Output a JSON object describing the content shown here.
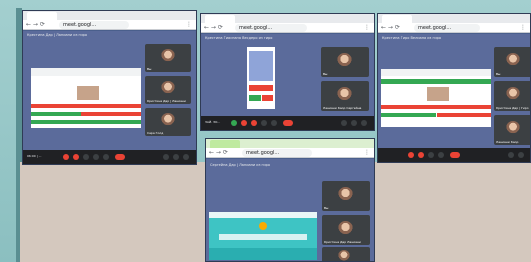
{
  "url": "meet.googl...",
  "windows": [
    {
      "id": "win-left",
      "meeting_title": "Крестина Дар | Ланиани из гиро",
      "participants": [
        "Вы",
        "Кристина Дар | Ланиани",
        "Сара Голд"
      ],
      "time": "06:00 | ..."
    },
    {
      "id": "win-center",
      "meeting_title": "Крестина Гиаспана Весдеро из гиро",
      "participants": [
        "Вы",
        "Ланиани Каор Сергейна"
      ],
      "time": "ЗАЙ. ЗО..."
    },
    {
      "id": "win-right",
      "meeting_title": "Крестина Гиро Велиана из гиро",
      "participants": [
        "Вы",
        "Кристина Дар | Гиро",
        "Ланиани Каор"
      ],
      "time": ""
    },
    {
      "id": "win-bottom",
      "meeting_title": "Сергейна Дар | Ланиани из гиро",
      "participants": [
        "Вы",
        "Кристина Дар Ланиани"
      ],
      "time": ""
    }
  ],
  "colors": {
    "meet_bg": "#5b6b9b",
    "controls_bg": "#202124",
    "end_call": "#ea4335",
    "slide_green": "#34a853",
    "slide_red": "#ea4335",
    "slide_teal": "#3ec4c4"
  }
}
